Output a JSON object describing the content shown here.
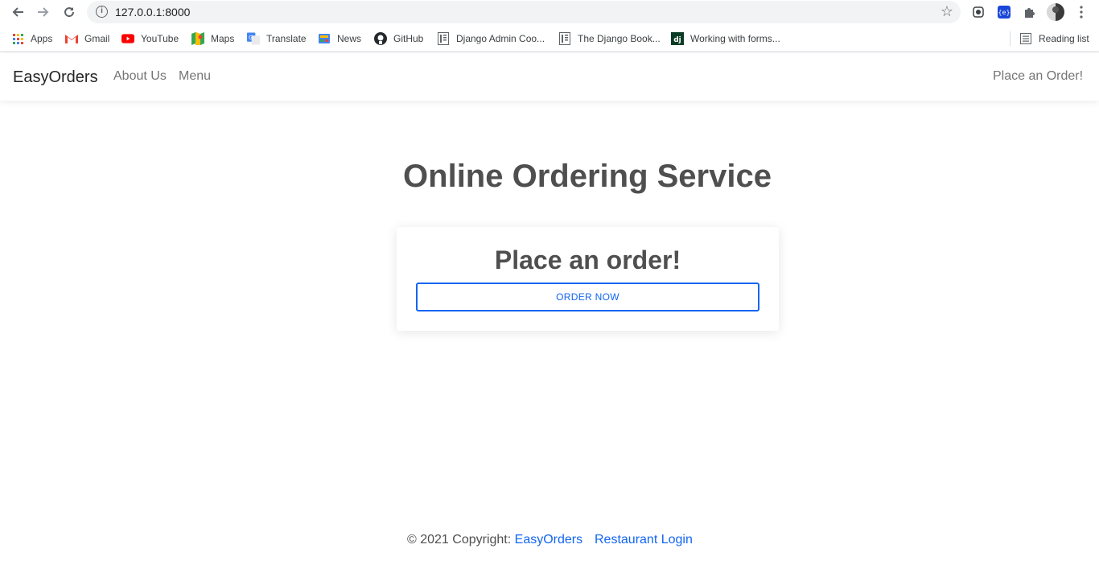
{
  "browser": {
    "url": "127.0.0.1:8000",
    "bookmarks": [
      {
        "label": "Apps",
        "icon": "apps-grid-icon"
      },
      {
        "label": "Gmail",
        "icon": "gmail-icon"
      },
      {
        "label": "YouTube",
        "icon": "youtube-icon"
      },
      {
        "label": "Maps",
        "icon": "maps-icon"
      },
      {
        "label": "Translate",
        "icon": "translate-icon"
      },
      {
        "label": "News",
        "icon": "news-icon"
      },
      {
        "label": "GitHub",
        "icon": "github-icon"
      },
      {
        "label": "Django Admin Coo...",
        "icon": "page-icon"
      },
      {
        "label": "The Django Book...",
        "icon": "page-icon"
      },
      {
        "label": "Working with forms...",
        "icon": "django-icon"
      }
    ],
    "reading_list": "Reading list"
  },
  "navbar": {
    "brand": "EasyOrders",
    "links": [
      "About Us",
      "Menu"
    ],
    "cta": "Place an Order!"
  },
  "main": {
    "title": "Online Ordering Service",
    "card_title": "Place an order!",
    "button": "ORDER NOW"
  },
  "footer": {
    "copyright": "© 2021 Copyright: ",
    "brand_link": "EasyOrders",
    "login_link": "Restaurant Login"
  },
  "colors": {
    "accent": "#1266f1",
    "text": "#4f4f4f"
  }
}
